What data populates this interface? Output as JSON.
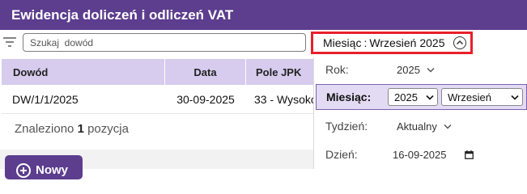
{
  "window": {
    "title": "Ewidencja doliczeń i odliczeń VAT"
  },
  "toolbar": {
    "filter_icon": "filter-icon",
    "search_placeholder": "Szukaj  dowód",
    "month_toggle": {
      "label": "Miesiąc",
      "separator": ":",
      "value": "Wrzesień 2025",
      "icon": "chevron-up-circle-icon",
      "highlight_color": "#e8202a"
    }
  },
  "table": {
    "columns": [
      "Dowód",
      "Data",
      "Pole JPK"
    ],
    "rows": [
      {
        "dowod": "DW/1/1/2025",
        "data": "30-09-2025",
        "pole_jpk": "33 - Wysoko"
      }
    ],
    "header_color": "#d7cbee"
  },
  "summary": {
    "prefix": "Znaleziono",
    "count": "1",
    "suffix": "pozycja"
  },
  "actions": {
    "new_label": "Nowy",
    "new_icon": "plus-circle-icon"
  },
  "period_panel": {
    "rok": {
      "label": "Rok:",
      "value": "2025"
    },
    "miesiac": {
      "label": "Miesiąc:",
      "year_value": "2025",
      "month_value": "Wrzesień"
    },
    "tydzien": {
      "label": "Tydzień:",
      "value": "Aktualny"
    },
    "dzien": {
      "label": "Dzień:",
      "value": "16-09-2025",
      "icon": "calendar-icon"
    }
  },
  "colors": {
    "brand": "#5c3d8e",
    "highlight": "#e8202a",
    "selected_row": "#e3dbf3"
  }
}
